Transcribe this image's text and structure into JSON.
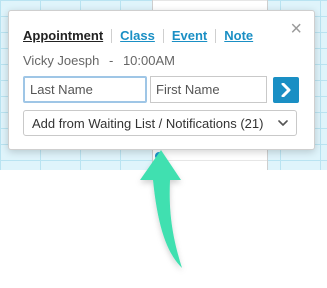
{
  "popup": {
    "tabs": [
      {
        "label": "Appointment"
      },
      {
        "label": "Class"
      },
      {
        "label": "Event"
      },
      {
        "label": "Note"
      }
    ],
    "client_name": "Vicky Joesph",
    "separator": "-",
    "time": "10:00AM",
    "last_name_placeholder": "Last Name",
    "first_name_placeholder": "First Name",
    "waiting_list_select": "Add from Waiting List / Notifications (21)",
    "close_symbol": "×"
  },
  "colors": {
    "accent": "#1a8fc4",
    "grid_blue": "#dff4fb",
    "arrow_green": "#3fe0b0"
  },
  "icons": {
    "close": "close-icon",
    "next": "chevron-right-icon",
    "dropdown": "chevron-down-icon"
  }
}
